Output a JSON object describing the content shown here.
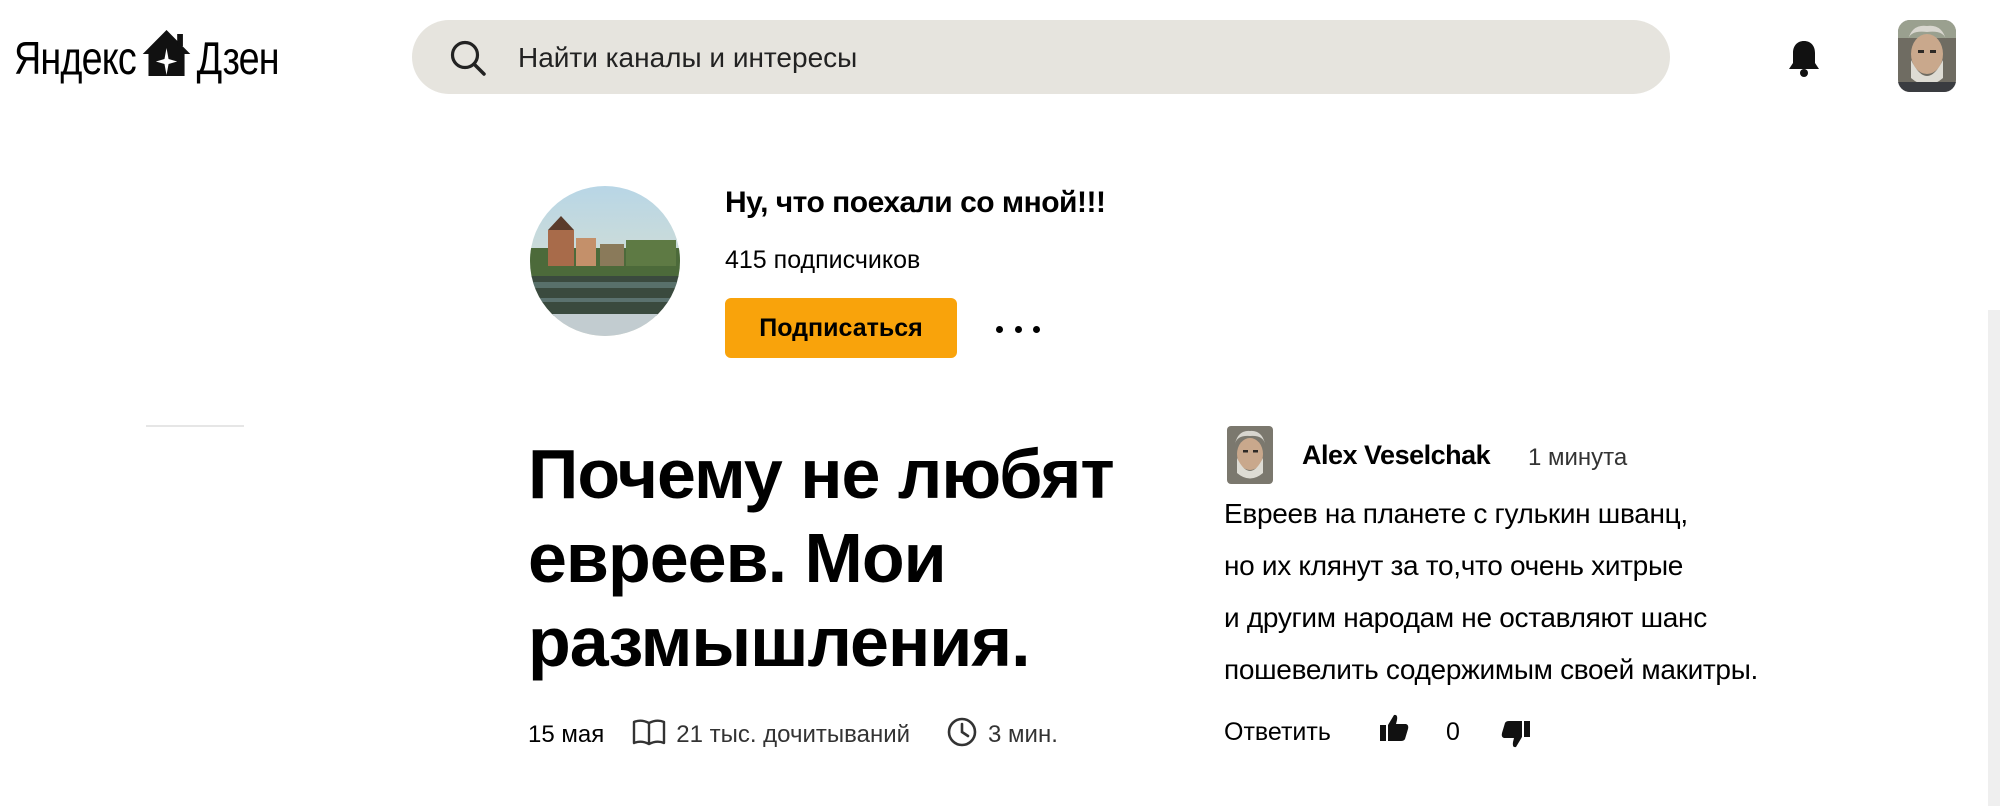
{
  "header": {
    "logo_left": "Яндекс",
    "logo_right": "Дзен",
    "search_placeholder": "Найти каналы и интересы"
  },
  "channel": {
    "name": "Ну, что поехали со мной!!!",
    "subscribers": "415 подписчиков",
    "subscribe_label": "Подписаться"
  },
  "article": {
    "title": "Почему не любят евреев. Мои размышления.",
    "date": "15 мая",
    "reads": "21 тыс. дочитываний",
    "read_time": "3 мин."
  },
  "comment": {
    "author": "Alex Veselchak",
    "time": "1 минута",
    "lines": [
      "Евреев на планете с гулькин шванц,",
      "но их клянут за то,что очень хитрые",
      "и другим народам не оставляют шанс",
      "пошевелить содержимым своей макитры."
    ],
    "reply_label": "Ответить",
    "likes": "0"
  },
  "icons": {
    "search": "search-icon",
    "bell": "bell-icon",
    "more": "more-dots-icon",
    "book": "book-icon",
    "clock": "clock-icon",
    "like": "thumb-up-icon",
    "dislike": "thumb-down-icon",
    "logo_house": "house-star-icon"
  },
  "colors": {
    "accent": "#f9a30b",
    "search_bg": "#e6e4de"
  }
}
